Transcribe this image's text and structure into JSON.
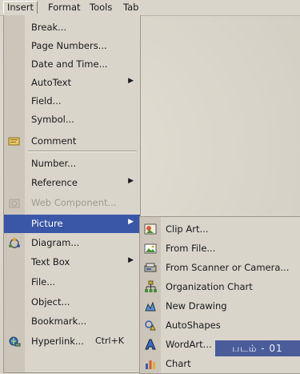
{
  "menubar": {
    "items": [
      {
        "label": "Insert"
      },
      {
        "label": "Format"
      },
      {
        "label": "Tools"
      },
      {
        "label": "Tab"
      }
    ]
  },
  "insert_menu": {
    "items": [
      {
        "label": "Break...",
        "icon": "none"
      },
      {
        "label": "Page Numbers...",
        "icon": "none"
      },
      {
        "label": "Date and Time...",
        "icon": "none"
      },
      {
        "label": "AutoText",
        "icon": "none",
        "submenu": true
      },
      {
        "label": "Field...",
        "icon": "none"
      },
      {
        "label": "Symbol...",
        "icon": "none"
      },
      {
        "label": "Comment",
        "icon": "comment-icon"
      },
      {
        "label": "Number...",
        "icon": "none"
      },
      {
        "label": "Reference",
        "icon": "none",
        "submenu": true
      },
      {
        "label": "Web Component...",
        "icon": "web-component-icon",
        "disabled": true
      },
      {
        "label": "Picture",
        "icon": "none",
        "submenu": true,
        "selected": true
      },
      {
        "label": "Diagram...",
        "icon": "diagram-icon"
      },
      {
        "label": "Text Box",
        "icon": "none",
        "submenu": true
      },
      {
        "label": "File...",
        "icon": "none"
      },
      {
        "label": "Object...",
        "icon": "none"
      },
      {
        "label": "Bookmark...",
        "icon": "none"
      },
      {
        "label": "Hyperlink...",
        "icon": "hyperlink-icon",
        "shortcut": "Ctrl+K"
      }
    ]
  },
  "picture_submenu": {
    "items": [
      {
        "label": "Clip Art...",
        "icon": "clip-art-icon"
      },
      {
        "label": "From File...",
        "icon": "from-file-icon"
      },
      {
        "label": "From Scanner or Camera...",
        "icon": "scanner-icon"
      },
      {
        "label": "Organization Chart",
        "icon": "org-chart-icon"
      },
      {
        "label": "New Drawing",
        "icon": "new-drawing-icon"
      },
      {
        "label": "AutoShapes",
        "icon": "autoshapes-icon"
      },
      {
        "label": "WordArt...",
        "icon": "wordart-icon"
      },
      {
        "label": "Chart",
        "icon": "chart-icon"
      }
    ]
  },
  "caption_tag": "படம் - 01",
  "colors": {
    "menu_bg": "#d9d5cb",
    "selection": "#3a56a6",
    "tag": "#4a5d9a"
  }
}
